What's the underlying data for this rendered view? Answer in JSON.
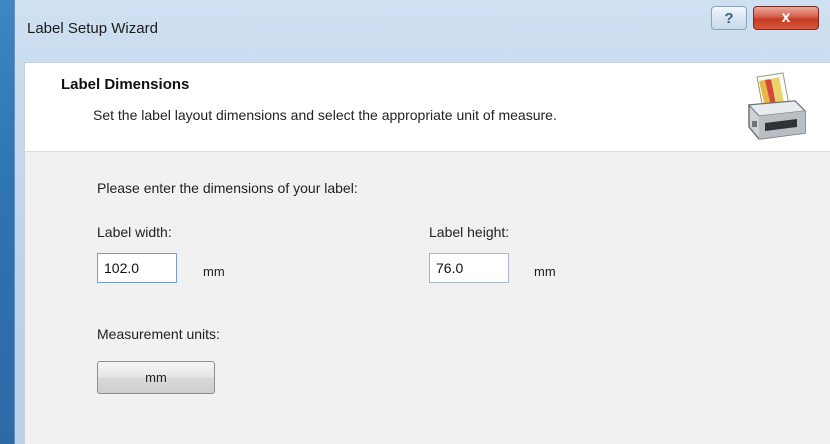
{
  "window": {
    "title": "Label Setup Wizard",
    "help_glyph": "?",
    "close_glyph": "x"
  },
  "header": {
    "title": "Label Dimensions",
    "subtitle": "Set the label layout dimensions and select the appropriate unit of measure.",
    "icon": "printer-icon"
  },
  "form": {
    "prompt": "Please enter the dimensions of your label:",
    "width_label": "Label width:",
    "width_value": "102.0",
    "width_unit": "mm",
    "height_label": "Label height:",
    "height_value": "76.0",
    "height_unit": "mm",
    "units_label": "Measurement units:",
    "units_button": "mm"
  }
}
